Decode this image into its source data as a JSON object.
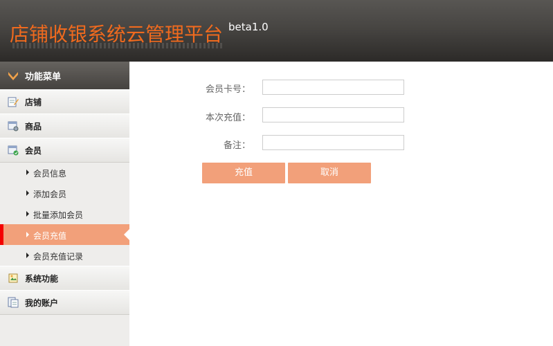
{
  "header": {
    "title": "店铺收银系统云管理平台",
    "version": "beta1.0",
    "title_color": "#f06a1e"
  },
  "sidebar": {
    "menu_title": "功能菜单",
    "items": [
      {
        "label": "店铺",
        "icon": "edit-note-icon"
      },
      {
        "label": "商品",
        "icon": "product-settings-icon"
      },
      {
        "label": "会员",
        "icon": "member-card-icon"
      },
      {
        "label": "系统功能",
        "icon": "system-image-icon"
      },
      {
        "label": "我的账户",
        "icon": "account-document-icon"
      }
    ],
    "member_sub_items": [
      {
        "label": "会员信息"
      },
      {
        "label": "添加会员"
      },
      {
        "label": "批量添加会员"
      },
      {
        "label": "会员充值",
        "active": true
      },
      {
        "label": "会员充值记录"
      }
    ],
    "active_color": "#f2a07a",
    "active_marker_color": "#f40000"
  },
  "form": {
    "card_label": "会员卡号：",
    "card_value": "",
    "amount_label": "本次充值：",
    "amount_value": "",
    "note_label": "备注：",
    "note_value": "",
    "submit_label": "充值",
    "cancel_label": "取消",
    "button_color": "#f2a07a"
  }
}
